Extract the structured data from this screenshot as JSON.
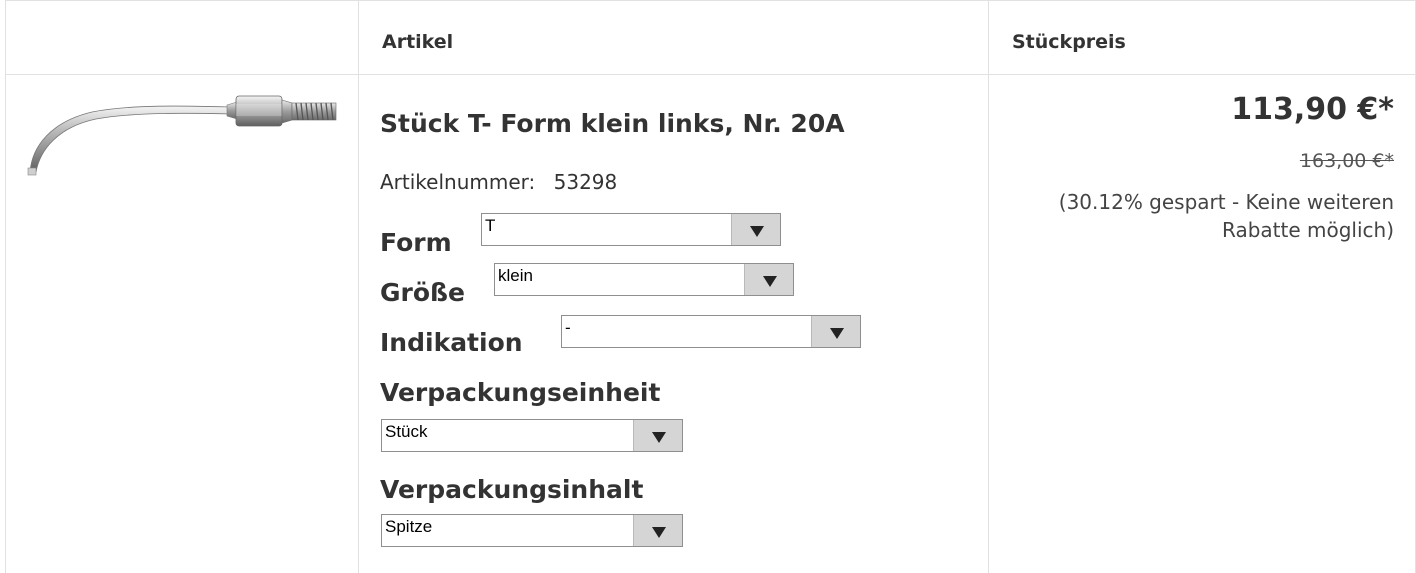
{
  "table": {
    "header": {
      "article": "Artikel",
      "unit_price": "Stückpreis"
    }
  },
  "product": {
    "image_alt": "dental scaler tip",
    "title": "Stück T- Form klein links, Nr. 20A",
    "article_number_label": "Artikelnummer:",
    "article_number": "53298",
    "options": {
      "form": {
        "label": "Form",
        "value": "T"
      },
      "size": {
        "label": "Größe",
        "value": "klein"
      },
      "indication": {
        "label": "Indikation",
        "value": "-"
      },
      "packaging_unit": {
        "label": "Verpackungseinheit",
        "value": "Stück"
      },
      "packaging_content": {
        "label": "Verpackungsinhalt",
        "value": "Spitze"
      }
    },
    "price": "113,90 €*",
    "old_price": "163,00 €*",
    "saving_note": "(30.12% gespart - Keine weiteren Rabatte möglich)"
  },
  "colors": {
    "border": "#e1e1e1",
    "text": "#333333",
    "select_arrow_bg": "#d5d5d5"
  },
  "icons": {
    "select_arrow": "triangle-down-icon"
  }
}
